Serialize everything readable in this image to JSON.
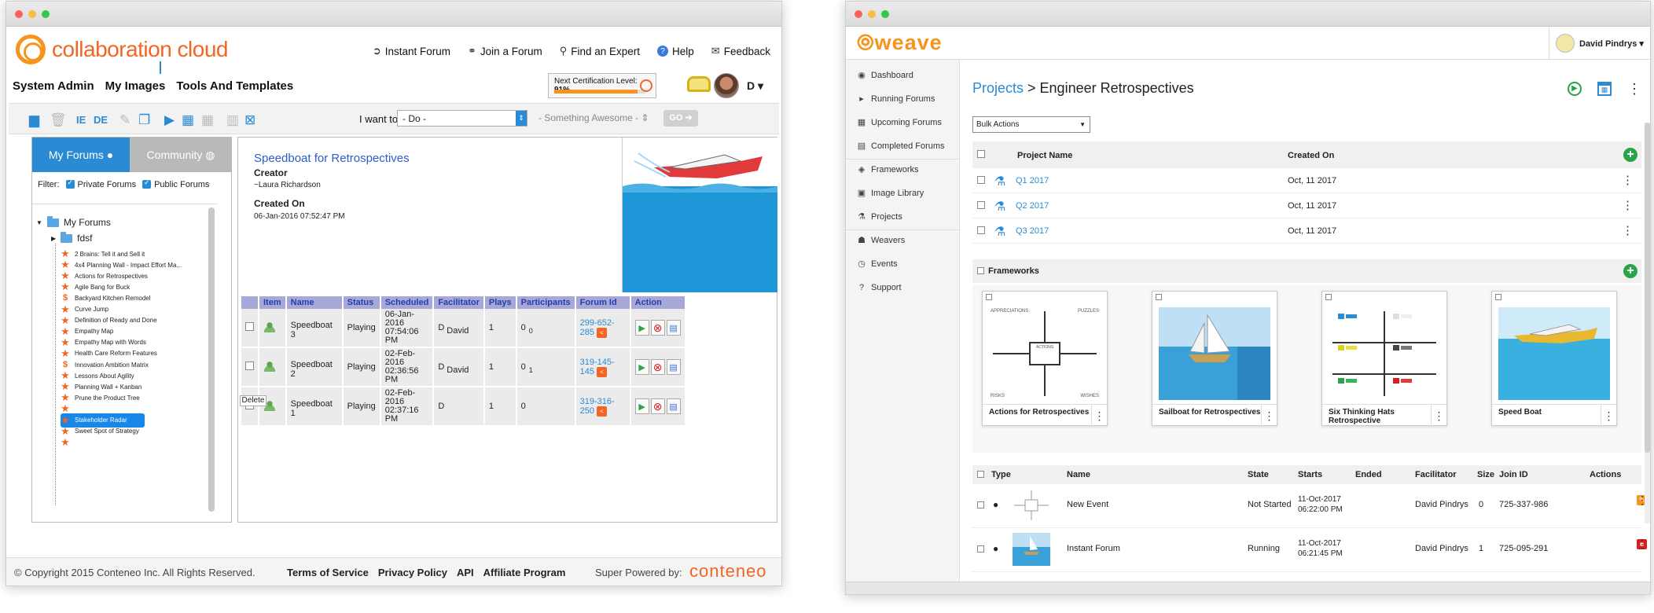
{
  "cc": {
    "brand": "collaboration cloud",
    "topnav": [
      "Instant Forum",
      "Join a Forum",
      "Find an Expert",
      "Help",
      "Feedback"
    ],
    "mainnav": [
      "System Admin",
      "My Images",
      "Tools And Templates"
    ],
    "cert_label": "Next Certification Level:",
    "cert_pct": "91%",
    "cert_fraction": 0.91,
    "user_initial": "D",
    "toolbar": {
      "ie": "IE",
      "de": "DE",
      "iwant": "I want to",
      "do": "- Do -",
      "something": "- Something Awesome -",
      "go": "GO"
    },
    "tabs": {
      "my": "My Forums",
      "community": "Community"
    },
    "filter": {
      "label": "Filter:",
      "private": "Private Forums",
      "public": "Public Forums"
    },
    "tree": {
      "root": "My Forums",
      "folder": "fdsf",
      "items": [
        "2 Brains: Tell it and Sell it",
        "4x4 Planning Wall - Impact Effort Ma...",
        "Actions for Retrospectives",
        "Agile Bang for Buck",
        "Backyard Kitchen Remodel",
        "Curve Jump",
        "Definition of Ready and Done",
        "Empathy Map",
        "Empathy Map with Words",
        "Health Care Reform Features",
        "Innovation Ambition Matrix",
        "Lessons About Agility",
        "Planning Wall + Kanban",
        "Prune the Product Tree",
        "",
        "Stakeholder Radar",
        "Sweet Spot of Strategy",
        ""
      ]
    },
    "forum": {
      "title": "Speedboat for Retrospectives",
      "creator_label": "Creator",
      "creator": "~Laura Richardson",
      "created_label": "Created On",
      "created": "06-Jan-2016 07:52:47 PM"
    },
    "table": {
      "headers": [
        "Item",
        "Name",
        "Status",
        "Scheduled",
        "Facilitator",
        "Plays",
        "Participants",
        "Forum Id",
        "Action"
      ],
      "rows": [
        {
          "name": "Speedboat 3",
          "status": "Playing",
          "sched1": "06-Jan-2016",
          "sched2": "07:54:06 PM",
          "fac_d": "D",
          "fac": "David",
          "plays": "1",
          "part": "0",
          "part2": "0",
          "fid": "299-652-285"
        },
        {
          "name": "Speedboat 2",
          "status": "Playing",
          "sched1": "02-Feb-2016",
          "sched2": "02:36:56 PM",
          "fac_d": "D",
          "fac": "David",
          "plays": "1",
          "part": "0",
          "part2": "1",
          "fid": "319-145-145"
        },
        {
          "name": "Speedboat 1",
          "status": "Playing",
          "sched1": "02-Feb-2016",
          "sched2": "02:37:16 PM",
          "fac_d": "D",
          "fac": "",
          "plays": "1",
          "part": "0",
          "part2": "",
          "fid": "319-316-250"
        }
      ],
      "delete": "Delete"
    },
    "footer": {
      "copy": "© Copyright 2015 Conteneo Inc. All Rights Reserved.",
      "links": [
        "Terms of Service",
        "Privacy Policy",
        "API",
        "Affiliate Program"
      ],
      "powered": "Super Powered by:",
      "brand": "conteneo"
    }
  },
  "wv": {
    "brand": "weave",
    "user": "David Pindrys",
    "sidebar": [
      "Dashboard",
      "Running Forums",
      "Upcoming Forums",
      "Completed Forums",
      "Frameworks",
      "Image Library",
      "Projects",
      "Weavers",
      "Events",
      "Support"
    ],
    "bc_link": "Projects",
    "bc_rest": " > Engineer Retrospectives",
    "bulk": "Bulk Actions",
    "ptable": {
      "h_name": "Project Name",
      "h_created": "Created On",
      "rows": [
        {
          "name": "Q1 2017",
          "created": "Oct, 11 2017"
        },
        {
          "name": "Q2 2017",
          "created": "Oct, 11 2017"
        },
        {
          "name": "Q3 2017",
          "created": "Oct, 11 2017"
        }
      ]
    },
    "frameworks_label": "Frameworks",
    "cards": [
      {
        "title": "Actions for Retrospectives",
        "q1": "APPRECIATIONS",
        "q2": "PUZZLES",
        "q3": "RISKS",
        "q4": "WISHES",
        "center": "ACTIONS"
      },
      {
        "title": "Sailboat for Retrospectives"
      },
      {
        "title": "Six Thinking Hats Retrospective"
      },
      {
        "title": "Speed Boat"
      }
    ],
    "etable": {
      "headers": [
        "Type",
        "Name",
        "State",
        "Starts",
        "Ended",
        "Facilitator",
        "Size",
        "Join ID",
        "Actions"
      ],
      "rows": [
        {
          "name": "New Event",
          "state": "Not Started",
          "starts1": "11-Oct-2017",
          "starts2": "06:22:00 PM",
          "fac": "David Pindrys",
          "size": "0",
          "join": "725-337-986"
        },
        {
          "name": "Instant Forum",
          "state": "Running",
          "starts1": "11-Oct-2017",
          "starts2": "06:21:45 PM",
          "fac": "David Pindrys",
          "size": "1",
          "join": "725-095-291"
        }
      ]
    }
  }
}
